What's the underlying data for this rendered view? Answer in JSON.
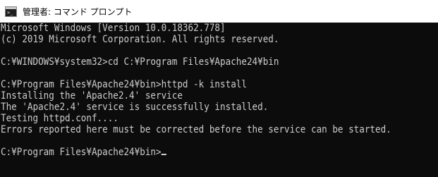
{
  "window": {
    "title": "管理者: コマンド プロンプト",
    "icon": "command-prompt-icon"
  },
  "console": {
    "lines": [
      "Microsoft Windows [Version 10.0.18362.778]",
      "(c) 2019 Microsoft Corporation. All rights reserved.",
      "",
      "C:¥WINDOWS¥system32>cd C:¥Program Files¥Apache24¥bin",
      "",
      "C:¥Program Files¥Apache24¥bin>httpd -k install",
      "Installing the 'Apache2.4' service",
      "The 'Apache2.4' service is successfully installed.",
      "Testing httpd.conf....",
      "Errors reported here must be corrected before the service can be started.",
      "",
      "C:¥Program Files¥Apache24¥bin>"
    ]
  },
  "colors": {
    "background": "#0c0c0c",
    "text": "#cccccc",
    "titlebar": "#ffffff"
  }
}
